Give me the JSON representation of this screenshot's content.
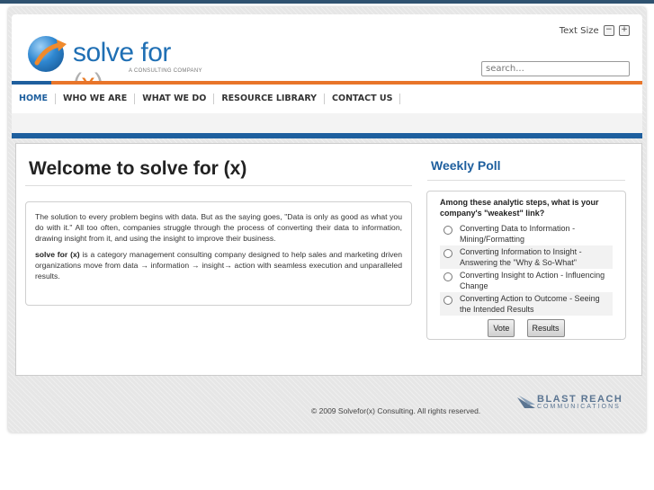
{
  "brand": {
    "name_main": "solve for",
    "name_paren_open": "(",
    "name_x": "x",
    "name_paren_close": ")",
    "tagline": "A CONSULTING COMPANY"
  },
  "header": {
    "text_size_label": "Text Size",
    "minus_symbol": "−",
    "plus_symbol": "+",
    "search_placeholder": "search..."
  },
  "nav": {
    "items": [
      "HOME",
      "WHO WE ARE",
      "WHAT WE DO",
      "RESOURCE LIBRARY",
      "CONTACT US"
    ],
    "active": "HOME"
  },
  "main": {
    "title": "Welcome to solve for (x)",
    "para1": "The solution to every problem begins with data. But as the saying goes, \"Data is only as good as what you do with it.\" All too often, companies struggle through the process of converting their data to information, drawing insight from it, and using the insight to improve their business.",
    "para2_bold": "solve for (x)",
    "para2_rest": " is a category management consulting company designed to help sales and marketing driven organizations move from data → information → insight→ action with seamless execution and unparalleled results."
  },
  "poll": {
    "title": "Weekly Poll",
    "question": "Among these analytic steps, what is your company's \"weakest\" link?",
    "options": [
      "Converting Data to Information - Mining/Formatting",
      "Converting Information to Insight - Answering the \"Why & So-What\"",
      "Converting Insight to Action - Influencing Change",
      "Converting Action to Outcome - Seeing the Intended Results"
    ],
    "vote_label": "Vote",
    "results_label": "Results"
  },
  "footer": {
    "copyright": "© 2009 Solvefor(x) Consulting. All rights reserved.",
    "partner_main": "BLAST REACH",
    "partner_sub": "COMMUNICATIONS"
  },
  "colors": {
    "brand_blue": "#1e5f9e",
    "accent_orange": "#e8752a",
    "top_bar": "#2f5270"
  }
}
